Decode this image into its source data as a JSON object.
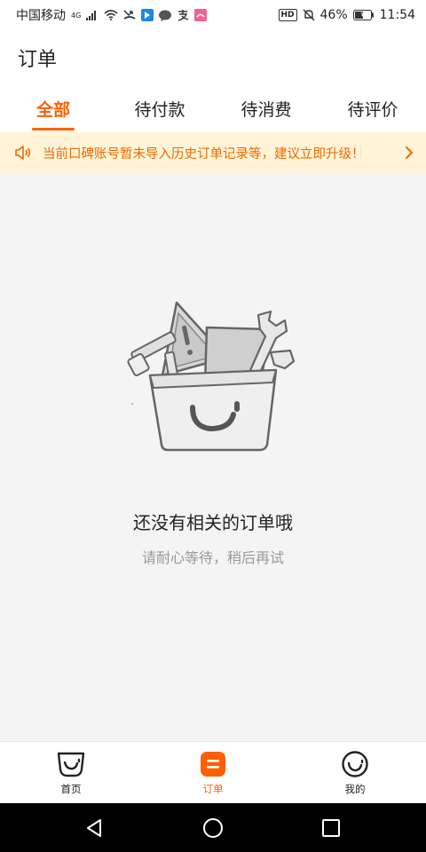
{
  "status_bar": {
    "carrier": "中国移动",
    "network": "4G",
    "hd": "HD",
    "battery": "46%",
    "time": "11:54"
  },
  "header": {
    "title": "订单"
  },
  "tabs": [
    {
      "label": "全部",
      "active": true
    },
    {
      "label": "待付款",
      "active": false
    },
    {
      "label": "待消费",
      "active": false
    },
    {
      "label": "待评价",
      "active": false
    }
  ],
  "notice": {
    "text": "当前口碑账号暂未导入历史订单记录等，建议立即升级！",
    "icon": "speaker-icon"
  },
  "empty_state": {
    "title": "还没有相关的订单哦",
    "subtitle": "请耐心等待，稍后再试"
  },
  "bottom_nav": [
    {
      "label": "首页",
      "icon": "home-icon",
      "active": false
    },
    {
      "label": "订单",
      "icon": "orders-icon",
      "active": true
    },
    {
      "label": "我的",
      "icon": "profile-icon",
      "active": false
    }
  ],
  "colors": {
    "accent": "#ff5f00",
    "notice_bg": "#fff4d8",
    "notice_text": "#ee6a00"
  }
}
